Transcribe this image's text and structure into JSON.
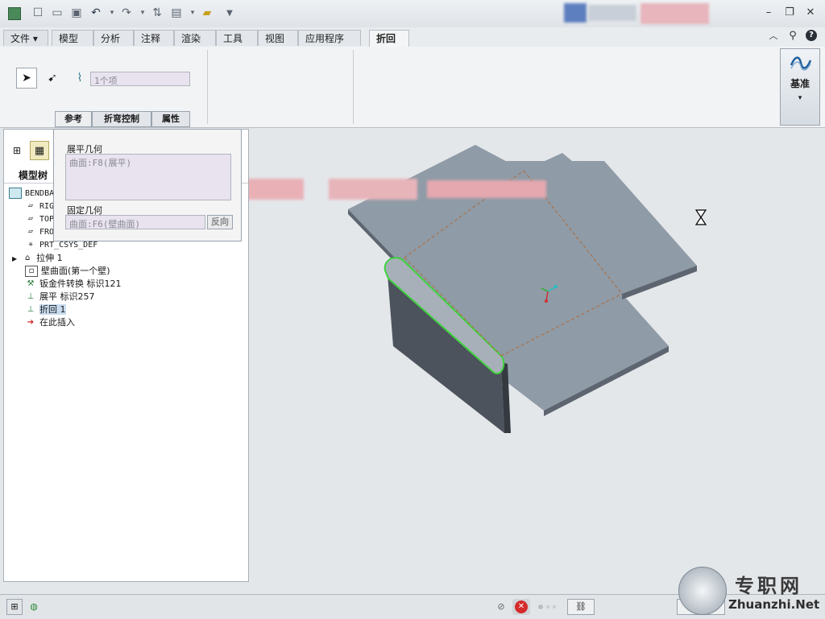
{
  "menu": {
    "file_label": "文件 ▾"
  },
  "tabs": [
    {
      "label": "模型"
    },
    {
      "label": "分析"
    },
    {
      "label": "注释"
    },
    {
      "label": "渲染"
    },
    {
      "label": "工具"
    },
    {
      "label": "视图"
    },
    {
      "label": "应用程序"
    },
    {
      "label": "折回"
    }
  ],
  "ribbon": {
    "selection_field": "1个项",
    "datum_label": "基准"
  },
  "dashboard_tabs": [
    {
      "label": "参考"
    },
    {
      "label": "折弯控制"
    },
    {
      "label": "属性"
    }
  ],
  "references": {
    "unbend_label": "展平几何",
    "unbend_value": "曲面:F8(展平)",
    "fixed_label": "固定几何",
    "fixed_value": "曲面:F6(壁曲面)",
    "flip_label": "反向"
  },
  "model_tree": {
    "tab_label": "模型树",
    "items": [
      {
        "label": "BENDBACK.PRT"
      },
      {
        "label": "RIG"
      },
      {
        "label": "TOP"
      },
      {
        "label": "FRO"
      },
      {
        "label": "PRT_CSYS_DEF"
      },
      {
        "label": "拉伸 1"
      },
      {
        "label": "壁曲面(第一个壁)"
      },
      {
        "label": "钣金件转换 标识121"
      },
      {
        "label": "展平 标识257"
      },
      {
        "label": "折回 1"
      },
      {
        "label": "在此插入"
      }
    ]
  },
  "watermark": {
    "brand": "专职网",
    "url": "Zhuanzhi.Net"
  },
  "colors": {
    "accent": "#2f6fb3",
    "model": "#8f9ba6",
    "highlight": "#3fd23f",
    "bend_line": "#b06a3a"
  }
}
